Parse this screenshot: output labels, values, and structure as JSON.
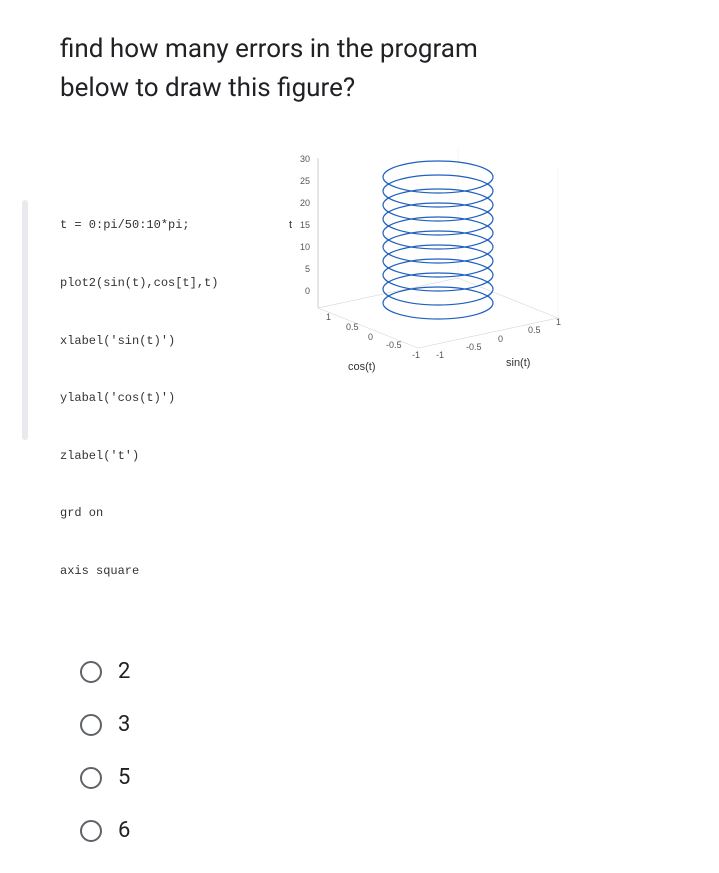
{
  "question": {
    "line1": "find how many errors in the program",
    "line2": "below to draw this figure?"
  },
  "code": {
    "l1": "t = 0:pi/50:10*pi;",
    "l2": "plot2(sin(t),cos[t],t)",
    "l3": "xlabel('sin(t)')",
    "l4": "ylabal('cos(t)')",
    "l5": "zlabel('t')",
    "l6": "grd on",
    "l7": "axis square"
  },
  "plot": {
    "zticks": [
      "30",
      "25",
      "20",
      "15",
      "10",
      "5",
      "0"
    ],
    "xticks": [
      "1",
      "0.5",
      "0",
      "-0.5",
      "-1"
    ],
    "yticks": [
      "-1",
      "-0.5",
      "0",
      "0.5",
      "1"
    ],
    "xlabel": "cos(t)",
    "ylabel": "sin(t)",
    "zlabel": "t"
  },
  "options": {
    "a": "2",
    "b": "3",
    "c": "5",
    "d": "6"
  }
}
